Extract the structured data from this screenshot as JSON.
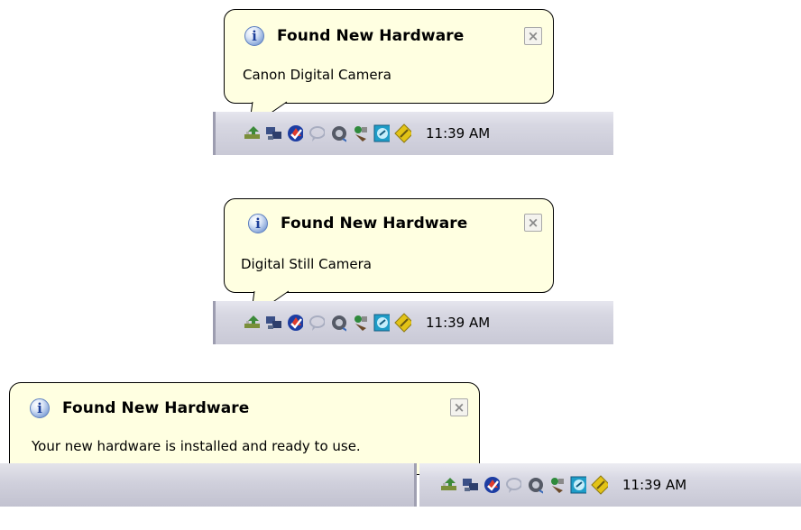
{
  "notifications": [
    {
      "title": "Found New Hardware",
      "message": "Canon Digital Camera",
      "close_symbol": "×",
      "info_symbol": "i",
      "clock": "11:39 AM"
    },
    {
      "title": "Found New Hardware",
      "message": "Digital Still Camera",
      "close_symbol": "×",
      "info_symbol": "i",
      "clock": "11:39 AM"
    },
    {
      "title": "Found New Hardware",
      "message": "Your new hardware is installed and ready to use.",
      "close_symbol": "×",
      "info_symbol": "i",
      "clock": "11:39 AM"
    }
  ],
  "tray_icons": [
    "safely-remove-hardware-icon",
    "network-connection-icon",
    "security-shield-icon",
    "chat-bubble-icon",
    "volume-icon",
    "sync-icon",
    "monitor-app-icon",
    "pencil-diamond-icon"
  ],
  "colors": {
    "balloon_bg": "#ffffe1",
    "balloon_border": "#000000",
    "taskbar": "#d3d3de",
    "info_icon": "#5d7fbf"
  }
}
